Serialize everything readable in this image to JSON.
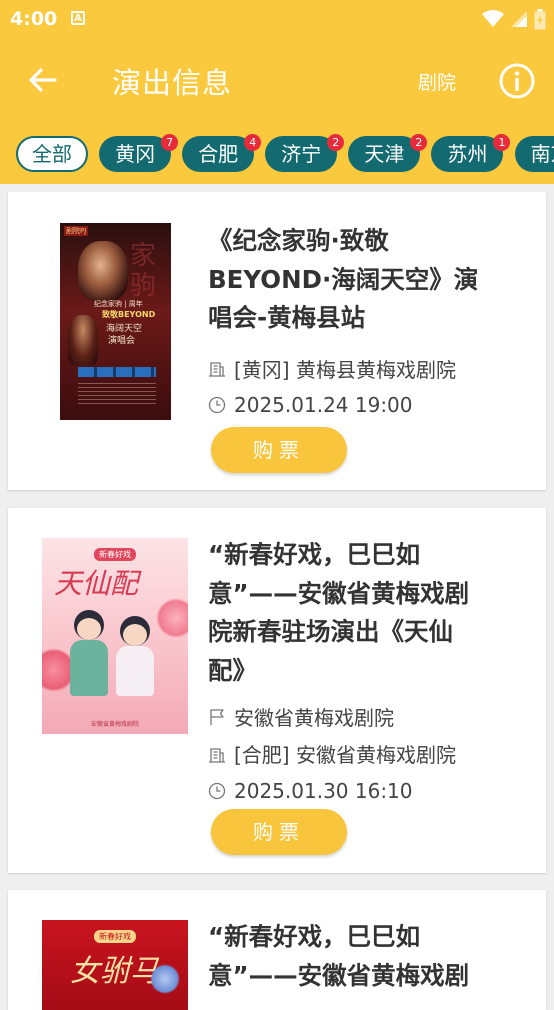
{
  "status_bar": {
    "time": "4:00",
    "a_badge": "A"
  },
  "app_bar": {
    "title": "演出信息",
    "theater_link": "剧院"
  },
  "filters": [
    {
      "label": "全部",
      "count": "",
      "active": true
    },
    {
      "label": "黄冈",
      "count": "7"
    },
    {
      "label": "合肥",
      "count": "4"
    },
    {
      "label": "济宁",
      "count": "2"
    },
    {
      "label": "天津",
      "count": "2"
    },
    {
      "label": "苏州",
      "count": "1"
    },
    {
      "label": "南京",
      "count": ""
    }
  ],
  "shows": [
    {
      "title": "《纪念家驹·致敬BEYOND·海阔天空》演唱会-黄梅县站",
      "venue": "[黄冈] 黄梅县黄梅戏剧院",
      "time": "2025.01.24 19:00",
      "buy_label": "购票",
      "poster": {
        "tag": "剧院PJ",
        "line1": "纪念家驹 | 周年",
        "line2": "致敬BEYOND",
        "line3": "海阔天空",
        "line4": "演唱会"
      }
    },
    {
      "title": "“新春好戏，巳巳如意”——安徽省黄梅戏剧院新春驻场演出《天仙配》",
      "organizer": "安徽省黄梅戏剧院",
      "venue": "[合肥] 安徽省黄梅戏剧院",
      "time": "2025.01.30 16:10",
      "buy_label": "购票",
      "poster": {
        "tag": "新春好戏",
        "calligraphy": "天仙配",
        "footer": "安徽省黄梅戏剧院"
      }
    },
    {
      "title": "“新春好戏，巳巳如意”——安徽省黄梅戏剧",
      "poster": {
        "tag": "新春好戏",
        "calligraphy": "女驸马"
      }
    }
  ],
  "colors": {
    "primary": "#fbc93e",
    "chip": "#136a71",
    "badge": "#e72b3b",
    "buy_button": "#f9c53d"
  }
}
